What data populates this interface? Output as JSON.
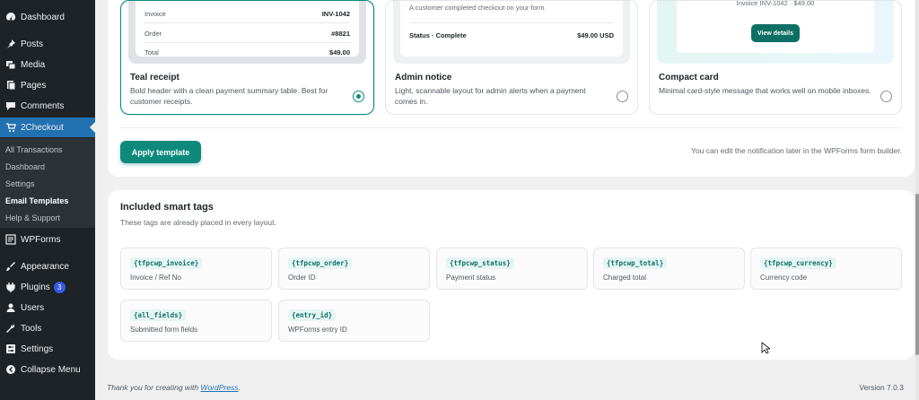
{
  "sidebar": {
    "items": [
      {
        "label": "Dashboard",
        "icon": "dashboard-icon"
      },
      {
        "label": "Posts",
        "icon": "pin-icon"
      },
      {
        "label": "Media",
        "icon": "media-icon"
      },
      {
        "label": "Pages",
        "icon": "page-icon"
      },
      {
        "label": "Comments",
        "icon": "comment-icon"
      },
      {
        "label": "2Checkout",
        "icon": "cart-icon"
      },
      {
        "label": "WPForms",
        "icon": "form-icon"
      },
      {
        "label": "Appearance",
        "icon": "brush-icon"
      },
      {
        "label": "Plugins",
        "icon": "plug-icon",
        "badge": "3"
      },
      {
        "label": "Users",
        "icon": "user-icon"
      },
      {
        "label": "Tools",
        "icon": "wrench-icon"
      },
      {
        "label": "Settings",
        "icon": "settings-icon"
      },
      {
        "label": "Collapse Menu",
        "icon": "collapse-icon"
      }
    ],
    "submenu": [
      "All Transactions",
      "Dashboard",
      "Settings",
      "Email Templates",
      "Help & Support"
    ]
  },
  "templates": [
    {
      "name": "Teal receipt",
      "desc": "Bold header with a clean payment summary table. Best for customer receipts.",
      "preview": {
        "invoice_label": "Invoice",
        "invoice_value": "INV-1042",
        "order_label": "Order",
        "order_value": "#8821",
        "total_label": "Total",
        "total_value": "$49.00"
      }
    },
    {
      "name": "Admin notice",
      "desc": "Light, scannable layout for admin alerts when a payment comes in.",
      "preview": {
        "message": "A customer completed checkout on your form.",
        "status": "Status · Complete",
        "amount": "$49.00 USD"
      }
    },
    {
      "name": "Compact card",
      "desc": "Minimal card-style message that works well on mobile inboxes.",
      "preview": {
        "line": "Invoice INV-1042 · $49.00",
        "button": "View details"
      }
    }
  ],
  "actions": {
    "apply_label": "Apply template",
    "hint": "You can edit the notification later in the WPForms form builder."
  },
  "smart_tags": {
    "title": "Included smart tags",
    "subtitle": "These tags are already placed in every layout.",
    "tags": [
      {
        "code": "{tfpcwp_invoice}",
        "desc": "Invoice / Ref No"
      },
      {
        "code": "{tfpcwp_order}",
        "desc": "Order ID"
      },
      {
        "code": "{tfpcwp_status}",
        "desc": "Payment status"
      },
      {
        "code": "{tfpcwp_total}",
        "desc": "Charged total"
      },
      {
        "code": "{tfpcwp_currency}",
        "desc": "Currency code"
      },
      {
        "code": "{all_fields}",
        "desc": "Submitted form fields"
      },
      {
        "code": "{entry_id}",
        "desc": "WPForms entry ID"
      }
    ]
  },
  "footer": {
    "thanks_prefix": "Thank you for creating with ",
    "wp_link": "WordPress",
    "thanks_suffix": ".",
    "version": "Version 7.0.3"
  },
  "colors": {
    "accent": "#0e8a7d",
    "admin_blue": "#2271b1",
    "sidebar": "#1d2327"
  }
}
